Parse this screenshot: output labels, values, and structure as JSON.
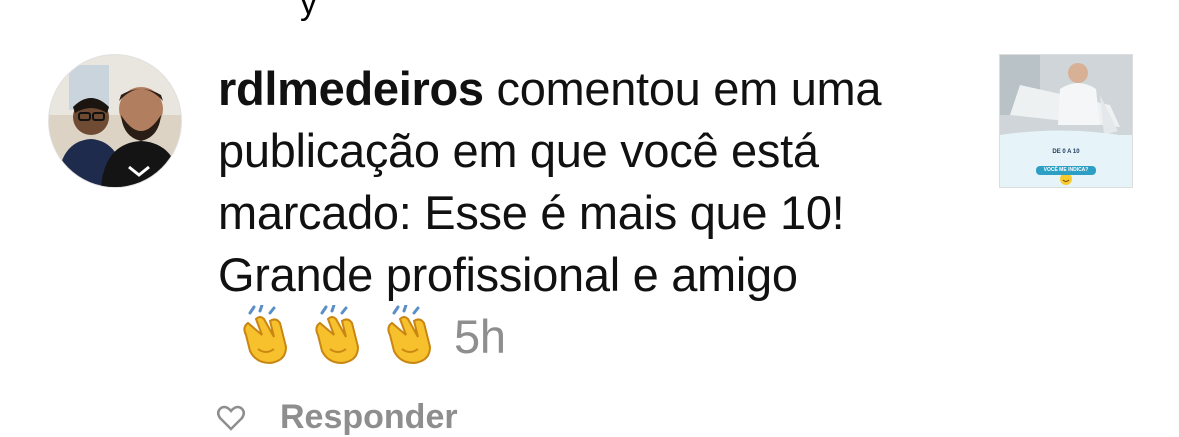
{
  "top_fragment": "y",
  "notification": {
    "username": "rdlmedeiros",
    "message": " comentou em uma publicação em que você está marcado: Esse é mais que 10! Grande profissional e amigo",
    "emojis": [
      "clapping-hands",
      "clapping-hands",
      "clapping-hands"
    ],
    "time": "5h"
  },
  "thumbnail": {
    "line1": "DE 0 A 10",
    "line2": "VOCÊ ME INDICA?"
  },
  "reply": {
    "label": "Responder"
  }
}
